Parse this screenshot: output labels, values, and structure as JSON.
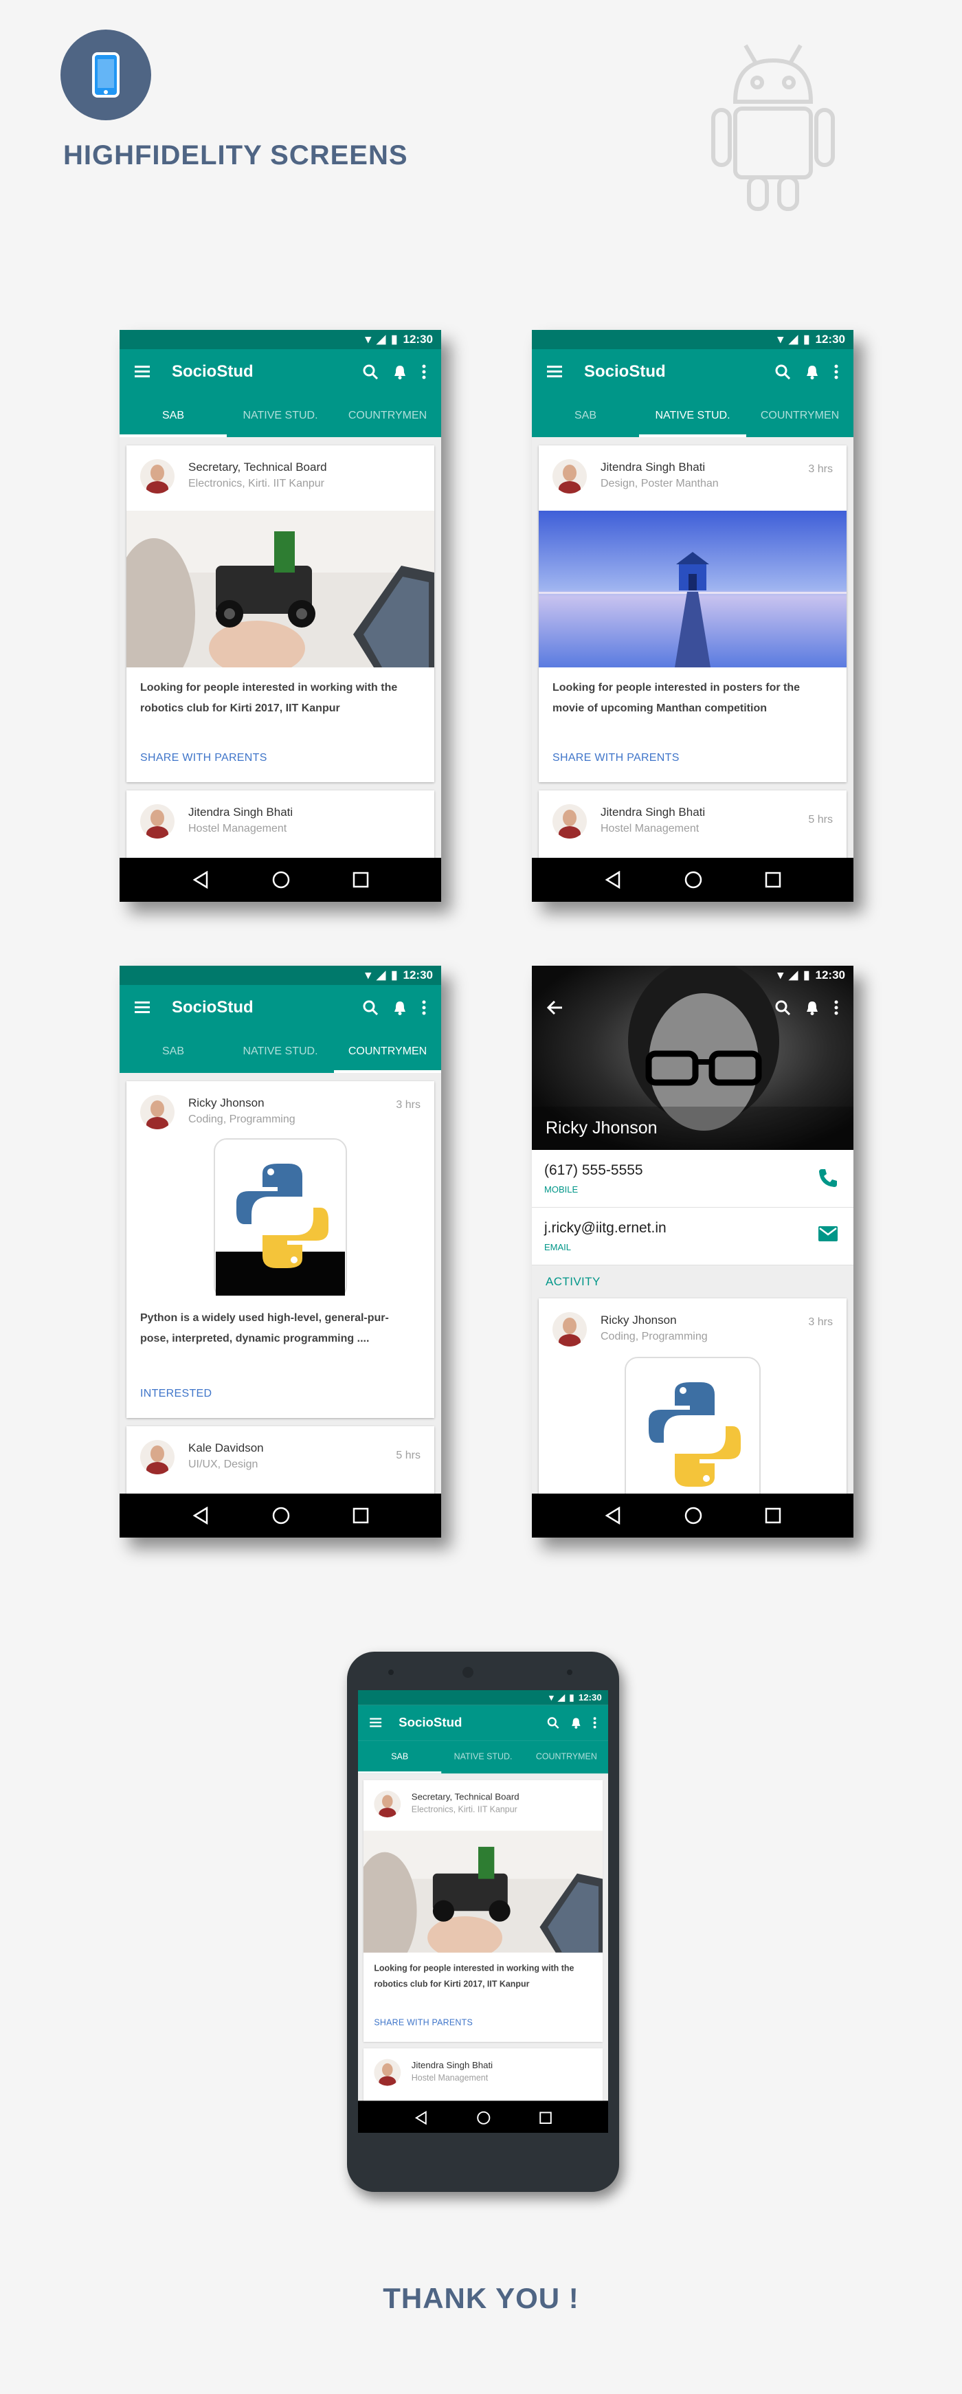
{
  "header": {
    "title": "HIGHFIDELITY SCREENS",
    "brand_color": "#4f6584",
    "icons": [
      "smartphone-icon",
      "android-icon"
    ]
  },
  "app": {
    "name": "SocioStud",
    "status_time": "12:30",
    "primary_color": "#009688",
    "tabs": [
      "SAB",
      "NATIVE STUD.",
      "COUNTRYMEN"
    ]
  },
  "screen1": {
    "active_tab": "SAB",
    "post": {
      "name": "Secretary, Technical Board",
      "subtitle": "Electronics, Kirti. IIT Kanpur",
      "desc_line1": "Looking for people interested in working with the",
      "desc_line2": "robotics club for Kirti 2017, IIT Kanpur",
      "action": "SHARE WITH PARENTS"
    },
    "next": {
      "name": "Jitendra Singh Bhati",
      "subtitle": "Hostel Management"
    }
  },
  "screen2": {
    "active_tab": "NATIVE STUD.",
    "post": {
      "name": "Jitendra Singh Bhati",
      "subtitle": "Design, Poster Manthan",
      "time": "3 hrs",
      "desc_line1": "Looking for people interested in posters for the",
      "desc_line2": "movie of upcoming Manthan competition",
      "action": "SHARE WITH PARENTS"
    },
    "next": {
      "name": "Jitendra Singh Bhati",
      "subtitle": "Hostel Management",
      "time": "5 hrs"
    }
  },
  "screen3": {
    "active_tab": "COUNTRYMEN",
    "post": {
      "name": "Ricky Jhonson",
      "subtitle": "Coding, Programming",
      "time": "3 hrs",
      "desc_line1": "Python is a widely used high-level, general-pur-",
      "desc_line2": "pose, interpreted, dynamic programming ....",
      "action": "INTERESTED"
    },
    "next": {
      "name": "Kale Davidson",
      "subtitle": "UI/UX, Design",
      "time": "5 hrs"
    }
  },
  "screen4": {
    "profile_name": "Ricky Jhonson",
    "phone": "(617) 555-5555",
    "phone_label": "MOBILE",
    "email": "j.ricky@iitg.ernet.in",
    "email_label": "EMAIL",
    "section": "ACTIVITY",
    "post": {
      "name": "Ricky Jhonson",
      "subtitle": "Coding, Programming",
      "time": "3 hrs"
    }
  },
  "footer": {
    "thanks": "THANK YOU !"
  }
}
